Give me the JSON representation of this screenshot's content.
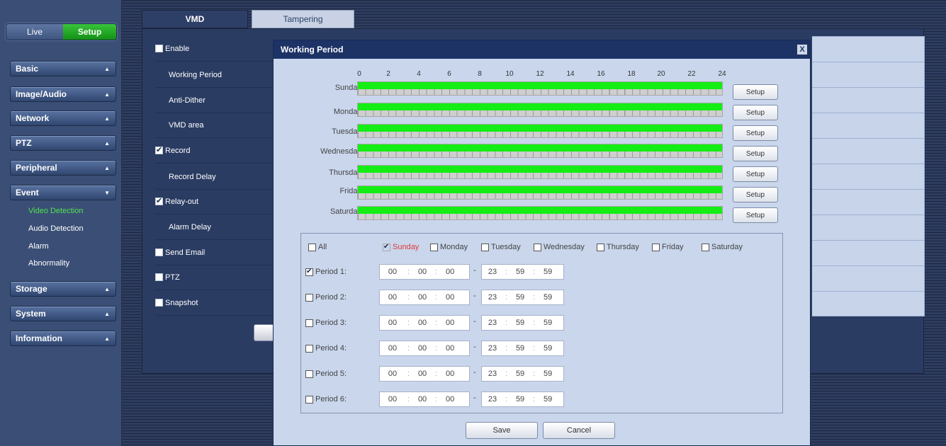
{
  "mode_toggle": {
    "live": "Live",
    "setup": "Setup"
  },
  "sidebar": {
    "menus": [
      {
        "label": "Basic",
        "arrow": "▲"
      },
      {
        "label": "Image/Audio",
        "arrow": "▲"
      },
      {
        "label": "Network",
        "arrow": "▲"
      },
      {
        "label": "PTZ",
        "arrow": "▲"
      },
      {
        "label": "Peripheral",
        "arrow": "▲"
      },
      {
        "label": "Event",
        "arrow": "▼"
      },
      {
        "label": "Storage",
        "arrow": "▲"
      },
      {
        "label": "System",
        "arrow": "▲"
      },
      {
        "label": "Information",
        "arrow": "▲"
      }
    ],
    "event_items": [
      "Video Detection",
      "Audio Detection",
      "Alarm",
      "Abnormality"
    ]
  },
  "tabs": [
    "VMD",
    "Tampering"
  ],
  "settings": [
    {
      "label": "Enable",
      "checkbox": true,
      "checked": false
    },
    {
      "label": "Working Period",
      "checkbox": false
    },
    {
      "label": "Anti-Dither",
      "checkbox": false
    },
    {
      "label": "VMD area",
      "checkbox": false
    },
    {
      "label": "Record",
      "checkbox": true,
      "checked": true
    },
    {
      "label": "Record Delay",
      "checkbox": false
    },
    {
      "label": "Relay-out",
      "checkbox": true,
      "checked": true
    },
    {
      "label": "Alarm Delay",
      "checkbox": false
    },
    {
      "label": "Send Email",
      "checkbox": true,
      "checked": false
    },
    {
      "label": "PTZ",
      "checkbox": true,
      "checked": false
    },
    {
      "label": "Snapshot",
      "checkbox": true,
      "checked": false
    }
  ],
  "dialog": {
    "title": "Working Period",
    "close": "X",
    "hours": [
      "0",
      "2",
      "4",
      "6",
      "8",
      "10",
      "12",
      "14",
      "16",
      "18",
      "20",
      "22",
      "24"
    ],
    "days": [
      "Sunday",
      "Monday",
      "Tuesday",
      "Wednesday",
      "Thursday",
      "Friday",
      "Saturday"
    ],
    "day_coverage": [
      1,
      1,
      1,
      1,
      1,
      1,
      1
    ],
    "day_setup_label": "Setup",
    "all_label": "All",
    "day_checks": [
      {
        "label": "Sunday",
        "checked": true,
        "active": true
      },
      {
        "label": "Monday",
        "checked": false
      },
      {
        "label": "Tuesday",
        "checked": false
      },
      {
        "label": "Wednesday",
        "checked": false
      },
      {
        "label": "Thursday",
        "checked": false
      },
      {
        "label": "Friday",
        "checked": false
      },
      {
        "label": "Saturday",
        "checked": false
      }
    ],
    "periods": [
      {
        "label": "Period 1:",
        "checked": true,
        "start": [
          "00",
          "00",
          "00"
        ],
        "end": [
          "23",
          "59",
          "59"
        ]
      },
      {
        "label": "Period 2:",
        "checked": false,
        "start": [
          "00",
          "00",
          "00"
        ],
        "end": [
          "23",
          "59",
          "59"
        ]
      },
      {
        "label": "Period 3:",
        "checked": false,
        "start": [
          "00",
          "00",
          "00"
        ],
        "end": [
          "23",
          "59",
          "59"
        ]
      },
      {
        "label": "Period 4:",
        "checked": false,
        "start": [
          "00",
          "00",
          "00"
        ],
        "end": [
          "23",
          "59",
          "59"
        ]
      },
      {
        "label": "Period 5:",
        "checked": false,
        "start": [
          "00",
          "00",
          "00"
        ],
        "end": [
          "23",
          "59",
          "59"
        ]
      },
      {
        "label": "Period 6:",
        "checked": false,
        "start": [
          "00",
          "00",
          "00"
        ],
        "end": [
          "23",
          "59",
          "59"
        ]
      }
    ],
    "time_sep": ":",
    "range_sep": "-",
    "save": "Save",
    "cancel": "Cancel"
  }
}
